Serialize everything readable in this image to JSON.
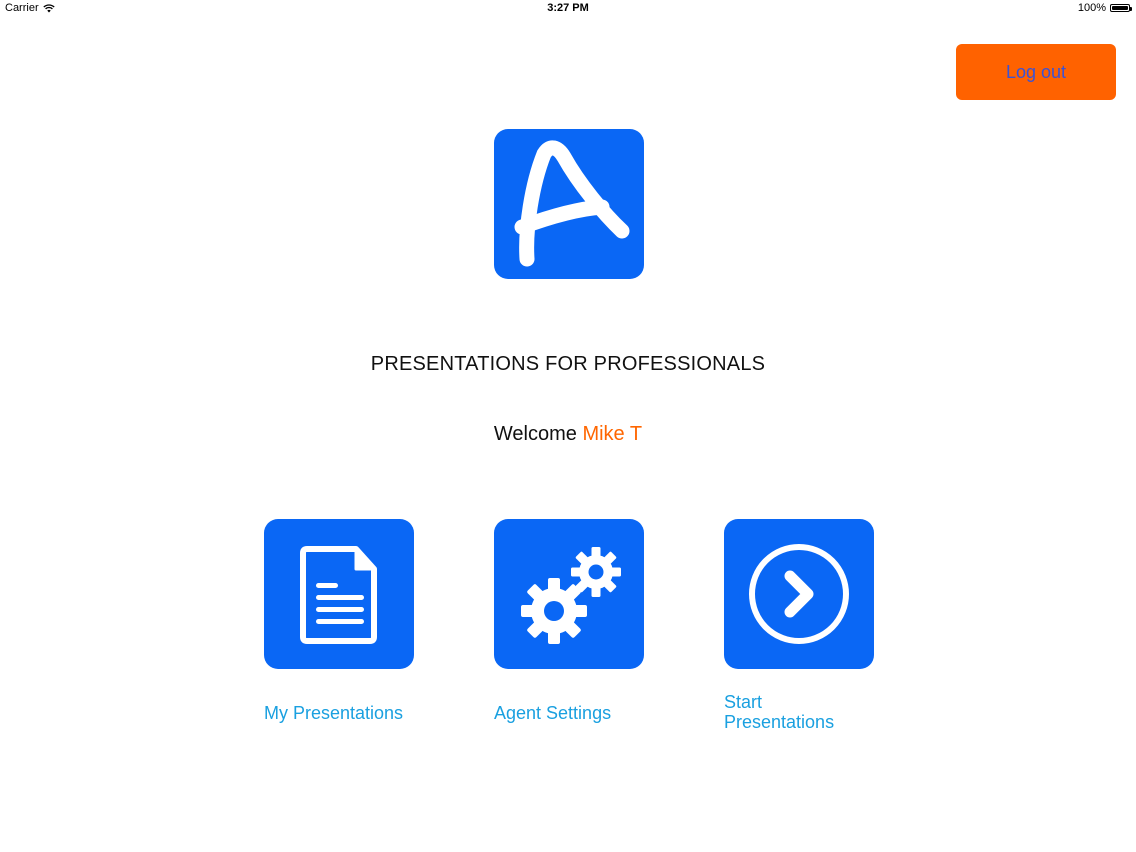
{
  "status_bar": {
    "carrier": "Carrier",
    "time": "3:27 PM",
    "battery": "100%"
  },
  "header": {
    "logout_label": "Log out"
  },
  "logo": {
    "letter_icon": "letter-a-logo"
  },
  "tagline": "PRESENTATIONS FOR PROFESSIONALS",
  "welcome": {
    "prefix": "Welcome",
    "user_name": "Mike T"
  },
  "tiles": [
    {
      "label": "My Presentations",
      "icon": "document-icon"
    },
    {
      "label": "Agent Settings",
      "icon": "gears-icon"
    },
    {
      "label_line1": "Start",
      "label_line2": "Presentations",
      "icon": "arrow-circle-icon"
    }
  ],
  "colors": {
    "accent_blue": "#0a67f5",
    "logout_orange": "#ff6200",
    "username_orange": "#ff6600",
    "link_blue": "#1aa0e0"
  }
}
